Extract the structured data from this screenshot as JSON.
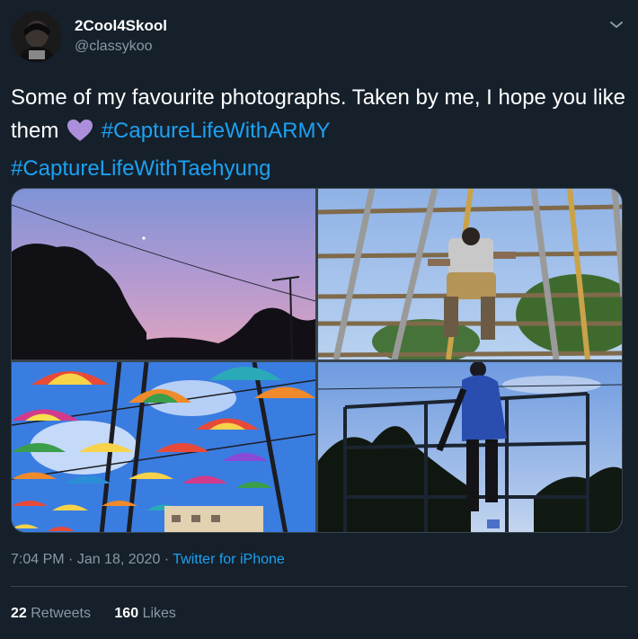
{
  "user": {
    "display_name": "2Cool4Skool",
    "handle": "@classykoo"
  },
  "tweet": {
    "text_part1": "Some of my favourite photographs. Taken by me, I hope you like them",
    "emoji": "purple-heart",
    "hashtag1": "#CaptureLifeWithARMY",
    "hashtag2": "#CaptureLifeWithTaehyung"
  },
  "media": {
    "photos": [
      {
        "subject": "sunset-sky-trees-photo"
      },
      {
        "subject": "climbing-frame-photo"
      },
      {
        "subject": "rainbow-umbrellas-photo"
      },
      {
        "subject": "silhouette-climber-photo"
      }
    ]
  },
  "meta": {
    "time": "7:04 PM",
    "separator": " · ",
    "date": "Jan 18, 2020",
    "source": "Twitter for iPhone"
  },
  "stats": {
    "retweets_count": "22",
    "retweets_label": "Retweets",
    "likes_count": "160",
    "likes_label": "Likes"
  },
  "colors": {
    "background": "#15202b",
    "accent": "#1da1f2",
    "secondary_text": "#8899a6",
    "heart": "#ac8fdc"
  }
}
